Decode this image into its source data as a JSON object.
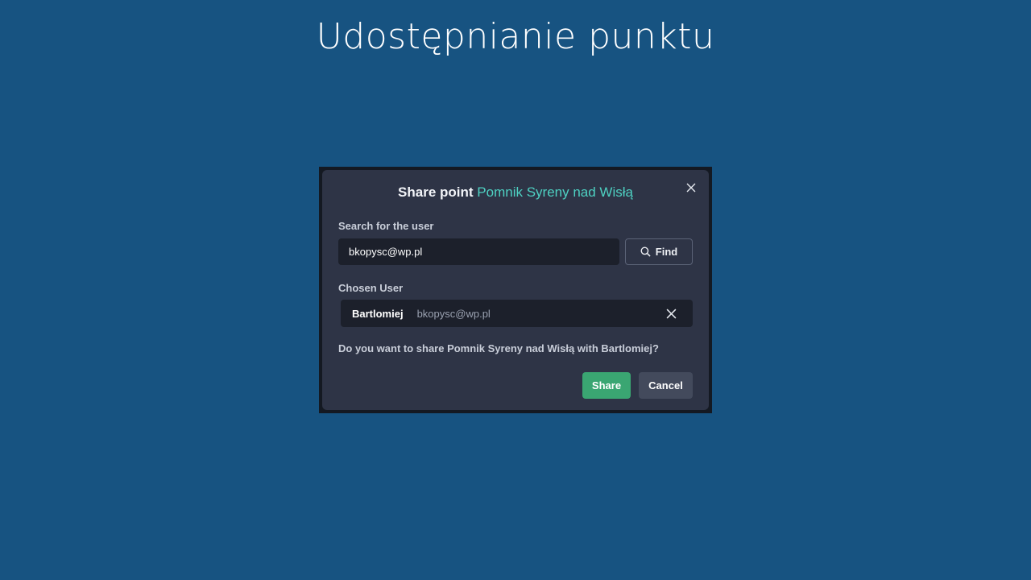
{
  "slide": {
    "title": "Udostępnianie punktu"
  },
  "dialog": {
    "title_prefix": "Share point",
    "point_name": "Pomnik Syreny nad Wisłą",
    "close_icon": "close-icon",
    "search": {
      "label": "Search for the user",
      "value": "bkopysc@wp.pl",
      "find_label": "Find",
      "find_icon": "search-icon"
    },
    "chosen": {
      "label": "Chosen User",
      "name": "Bartlomiej",
      "email": "bkopysc@wp.pl",
      "remove_icon": "close-icon"
    },
    "confirm_text": "Do you want to share Pomnik Syreny nad Wisłą with Bartlomiej?",
    "share_label": "Share",
    "cancel_label": "Cancel"
  },
  "colors": {
    "background": "#175381",
    "dialog": "#2e3446",
    "accent_teal": "#4ed1c2",
    "share_green": "#3aa672"
  }
}
